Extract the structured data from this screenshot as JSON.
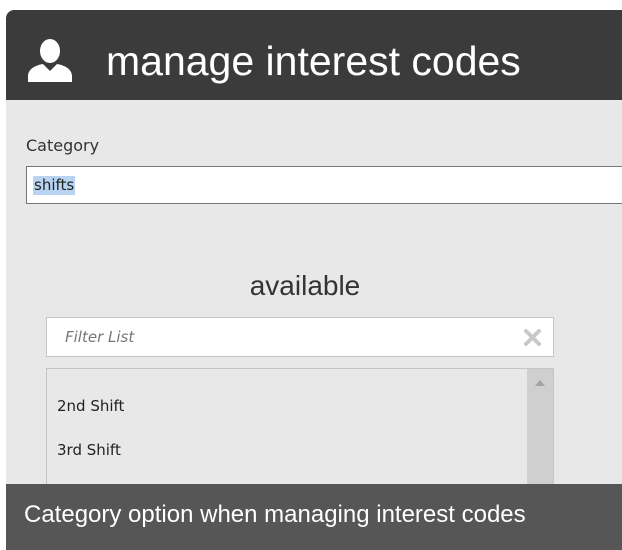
{
  "header": {
    "title": "manage interest codes",
    "icon": "user-icon"
  },
  "category": {
    "label": "Category",
    "value": "shifts"
  },
  "available": {
    "heading": "available",
    "filter": {
      "placeholder": "Filter List",
      "value": "",
      "clear_icon": "clear-x-icon"
    },
    "items": [
      {
        "label": "2nd Shift"
      },
      {
        "label": "3rd Shift"
      }
    ]
  },
  "caption": {
    "text": "Category option when managing interest codes"
  },
  "colors": {
    "titlebar": "#3b3b3b",
    "background": "#e8e8e8",
    "caption_bar": "#565656",
    "selection": "#b9d3f3"
  }
}
